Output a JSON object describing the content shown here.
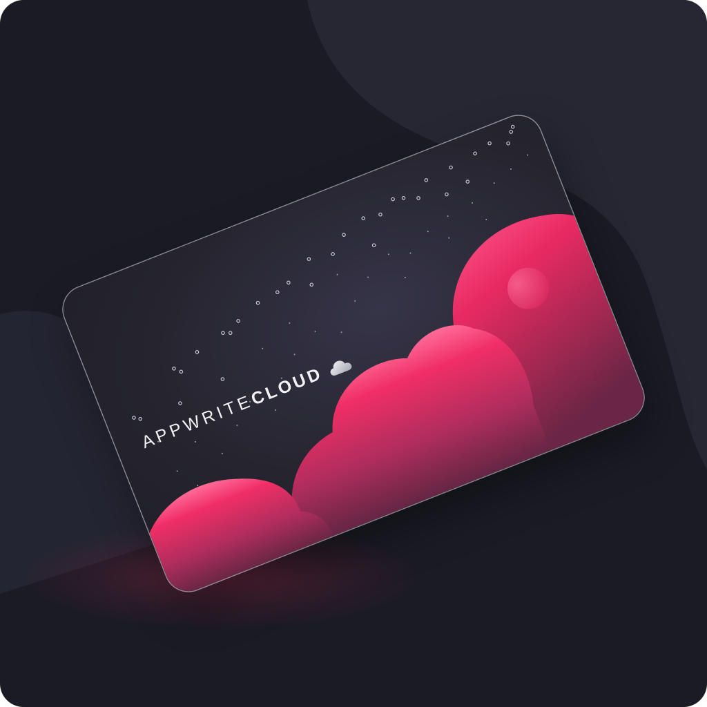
{
  "brand": {
    "light_text": "APPWRITE",
    "bold_text": "CLOUD",
    "icon": "cloud-icon"
  },
  "colors": {
    "background": "#1b1b25",
    "background_shape": "#262733",
    "card_base": "#26252f",
    "cloud_pink": "#f02e65",
    "cloud_highlight": "#ff5d8f",
    "text": "#f2f2f5"
  }
}
